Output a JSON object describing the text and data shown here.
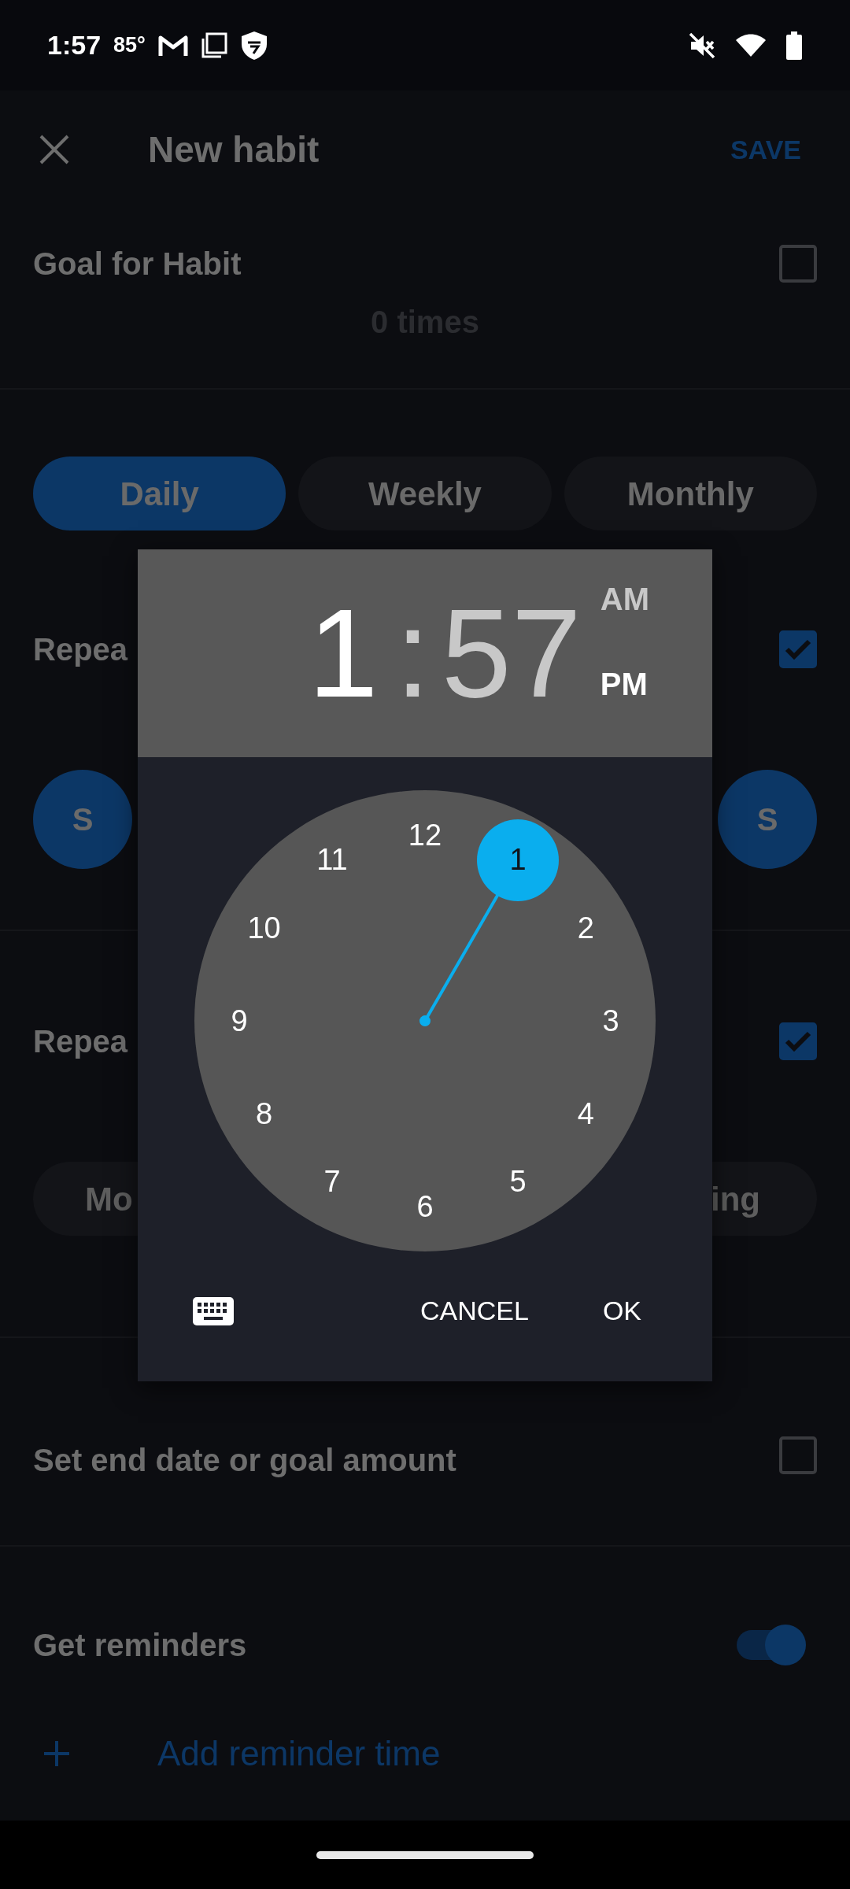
{
  "status_bar": {
    "time": "1:57",
    "temperature": "85°"
  },
  "header": {
    "title": "New habit",
    "save": "SAVE"
  },
  "goal": {
    "label": "Goal for Habit",
    "checked": false,
    "amount": "0 times"
  },
  "frequency_tabs": [
    {
      "label": "Daily",
      "selected": true
    },
    {
      "label": "Weekly",
      "selected": false
    },
    {
      "label": "Monthly",
      "selected": false
    }
  ],
  "repeat_days": {
    "label": "Repea",
    "checked": true,
    "days": [
      {
        "label": "S",
        "selected": true
      },
      {
        "label": "S",
        "selected": true
      }
    ]
  },
  "repeat_time": {
    "label": "Repea",
    "checked": true,
    "options": [
      {
        "label": "Mo",
        "selected": false
      },
      {
        "label": "ing",
        "selected": false
      }
    ]
  },
  "end_date": {
    "label": "Set end date or goal amount",
    "checked": false
  },
  "reminders": {
    "label": "Get reminders",
    "on": true,
    "add": "Add reminder time"
  },
  "time_picker": {
    "hour": {
      "text": "1",
      "selected": true
    },
    "separator": ":",
    "minute": {
      "text": "57",
      "selected": false
    },
    "periods": [
      {
        "label": "AM",
        "selected": false
      },
      {
        "label": "PM",
        "selected": true
      }
    ],
    "hours": [
      {
        "label": "12",
        "selected": false
      },
      {
        "label": "1",
        "selected": true
      },
      {
        "label": "2",
        "selected": false
      },
      {
        "label": "3",
        "selected": false
      },
      {
        "label": "4",
        "selected": false
      },
      {
        "label": "5",
        "selected": false
      },
      {
        "label": "6",
        "selected": false
      },
      {
        "label": "7",
        "selected": false
      },
      {
        "label": "8",
        "selected": false
      },
      {
        "label": "9",
        "selected": false
      },
      {
        "label": "10",
        "selected": false
      },
      {
        "label": "11",
        "selected": false
      }
    ],
    "buttons": [
      "CANCEL",
      "OK"
    ]
  }
}
